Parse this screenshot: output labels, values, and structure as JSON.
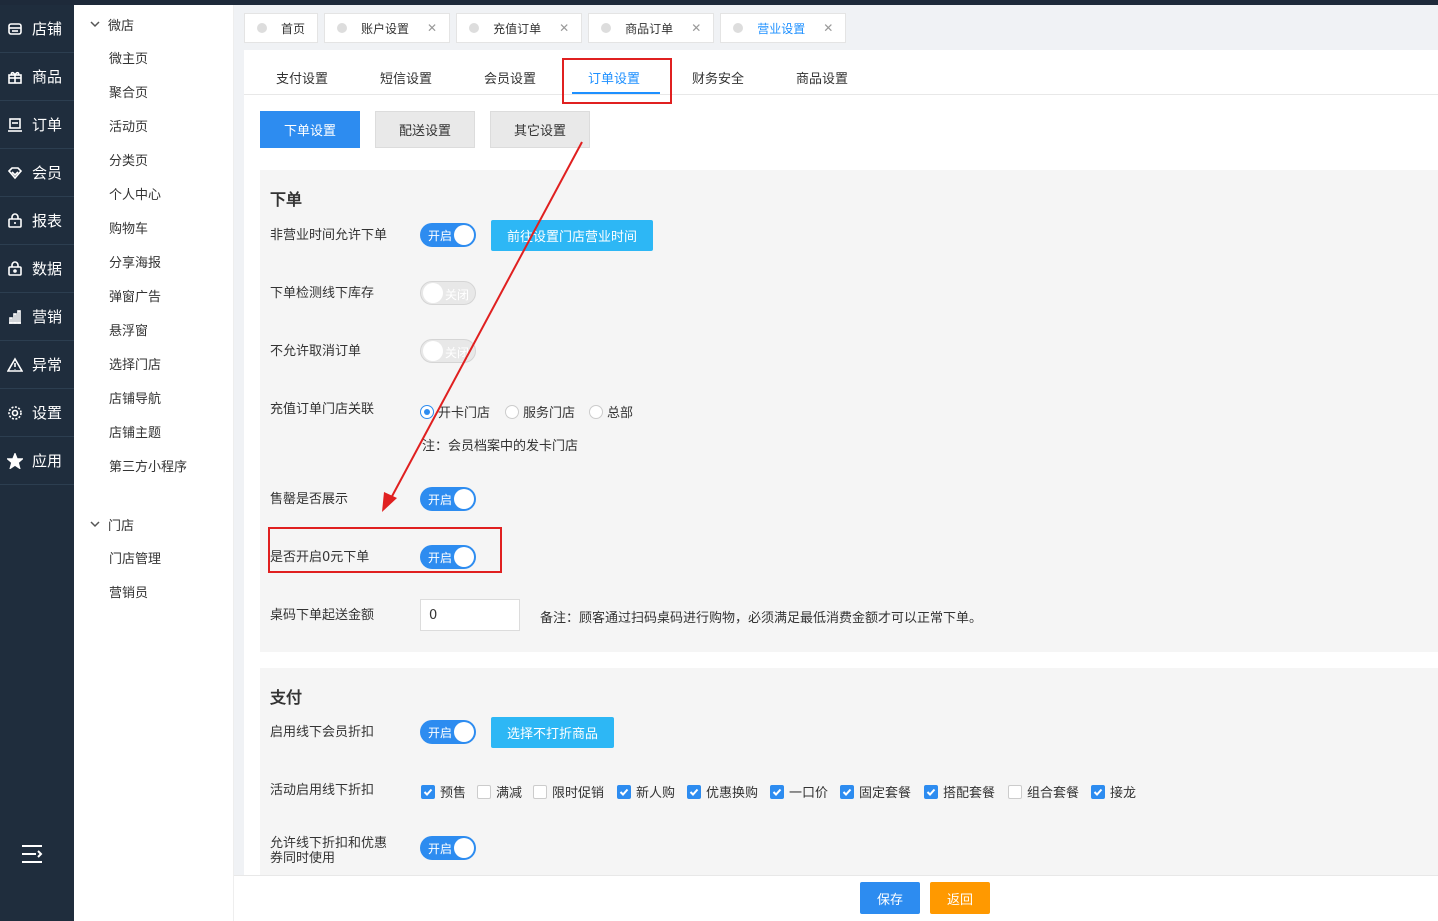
{
  "nav": {
    "items": [
      {
        "label": "店铺",
        "icon": "store-icon"
      },
      {
        "label": "商品",
        "icon": "gift-icon"
      },
      {
        "label": "订单",
        "icon": "order-icon"
      },
      {
        "label": "会员",
        "icon": "diamond-icon"
      },
      {
        "label": "报表",
        "icon": "lock-bag-icon"
      },
      {
        "label": "数据",
        "icon": "data-icon"
      },
      {
        "label": "营销",
        "icon": "bar-chart-icon"
      },
      {
        "label": "异常",
        "icon": "warning-icon"
      },
      {
        "label": "设置",
        "icon": "gear-icon"
      },
      {
        "label": "应用",
        "icon": "star-icon"
      }
    ]
  },
  "submenu": {
    "group1": "微店",
    "items1": [
      "微主页",
      "聚合页",
      "活动页",
      "分类页",
      "个人中心",
      "购物车",
      "分享海报",
      "弹窗广告",
      "悬浮窗",
      "选择门店",
      "店铺导航",
      "店铺主题",
      "第三方小程序"
    ],
    "group2": "门店",
    "items2": [
      "门店管理",
      "营销员"
    ]
  },
  "tabs": [
    {
      "label": "首页"
    },
    {
      "label": "账户设置"
    },
    {
      "label": "充值订单"
    },
    {
      "label": "商品订单"
    },
    {
      "label": "营业设置"
    }
  ],
  "subtabs": [
    "支付设置",
    "短信设置",
    "会员设置",
    "订单设置",
    "财务安全",
    "商品设置"
  ],
  "buttonTabs": [
    "下单设置",
    "配送设置",
    "其它设置"
  ],
  "order": {
    "title": "下单",
    "nonBusiness": {
      "label": "非营业时间允许下单",
      "state": "开启",
      "button": "前往设置门店营业时间"
    },
    "checkStock": {
      "label": "下单检测线下库存",
      "state": "关闭"
    },
    "noCancel": {
      "label": "不允许取消订单",
      "state": "关闭"
    },
    "rechargeStore": {
      "label": "充值订单门店关联",
      "options": [
        "开卡门店",
        "服务门店",
        "总部"
      ],
      "note": "注：会员档案中的发卡门店"
    },
    "soldOut": {
      "label": "售罄是否展示",
      "state": "开启"
    },
    "zeroOrder": {
      "label": "是否开启0元下单",
      "state": "开启"
    },
    "tableMin": {
      "label": "桌码下单起送金额",
      "value": "0",
      "note": "备注：顾客通过扫码桌码进行购物，必须满足最低消费金额才可以正常下单。"
    }
  },
  "pay": {
    "title": "支付",
    "memberDiscount": {
      "label": "启用线下会员折扣",
      "state": "开启",
      "button": "选择不打折商品"
    },
    "activityDiscount": {
      "label": "活动启用线下折扣",
      "options": [
        {
          "label": "预售",
          "checked": true
        },
        {
          "label": "满减",
          "checked": false
        },
        {
          "label": "限时促销",
          "checked": false
        },
        {
          "label": "新人购",
          "checked": true
        },
        {
          "label": "优惠换购",
          "checked": true
        },
        {
          "label": "一口价",
          "checked": true
        },
        {
          "label": "固定套餐",
          "checked": true
        },
        {
          "label": "搭配套餐",
          "checked": true
        },
        {
          "label": "组合套餐",
          "checked": false
        },
        {
          "label": "接龙",
          "checked": true
        }
      ]
    },
    "allowCombine": {
      "label1": "允许线下折扣和优惠",
      "label2": "券同时使用",
      "state": "开启"
    }
  },
  "footer": {
    "save": "保存",
    "back": "返回"
  },
  "colors": {
    "primary": "#2d8cf0",
    "info": "#2db7f5",
    "warning": "#ff9900",
    "highlight": "#e02020",
    "nav": "#1f2d3d"
  }
}
